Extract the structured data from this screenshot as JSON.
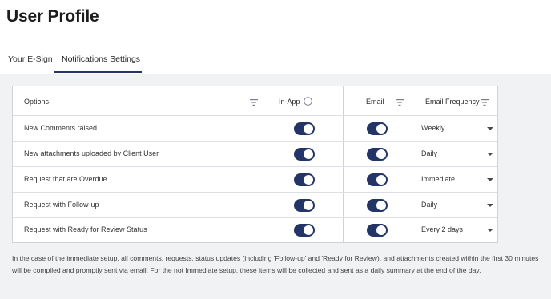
{
  "page": {
    "title": "User Profile"
  },
  "tabs": [
    {
      "label": "Your E-Sign",
      "active": false
    },
    {
      "label": "Notifications Settings",
      "active": true
    }
  ],
  "table": {
    "headers": {
      "options": "Options",
      "in_app": "In-App",
      "email": "Email",
      "email_frequency": "Email Frequency"
    },
    "rows": [
      {
        "option": "New Comments raised",
        "in_app": true,
        "email": true,
        "frequency": "Weekly"
      },
      {
        "option": "New attachments uploaded by Client User",
        "in_app": true,
        "email": true,
        "frequency": "Daily"
      },
      {
        "option": "Request that are Overdue",
        "in_app": true,
        "email": true,
        "frequency": "Immediate"
      },
      {
        "option": "Request with Follow-up",
        "in_app": true,
        "email": true,
        "frequency": "Daily"
      },
      {
        "option": "Request with Ready for Review Status",
        "in_app": true,
        "email": true,
        "frequency": "Every 2 days"
      }
    ]
  },
  "footnote": "In the case of the immediate setup, all comments, requests, status updates (including 'Follow-up' and 'Ready for Review), and attachments created within the first 30 minutes will be compiled and promptly sent via email. For the not Immediate setup, these items will be collected and sent as a daily summary at the end of the day.",
  "colors": {
    "toggle_on": "#233466",
    "tab_underline": "#223668",
    "panel_bg": "#f1f2f4"
  }
}
